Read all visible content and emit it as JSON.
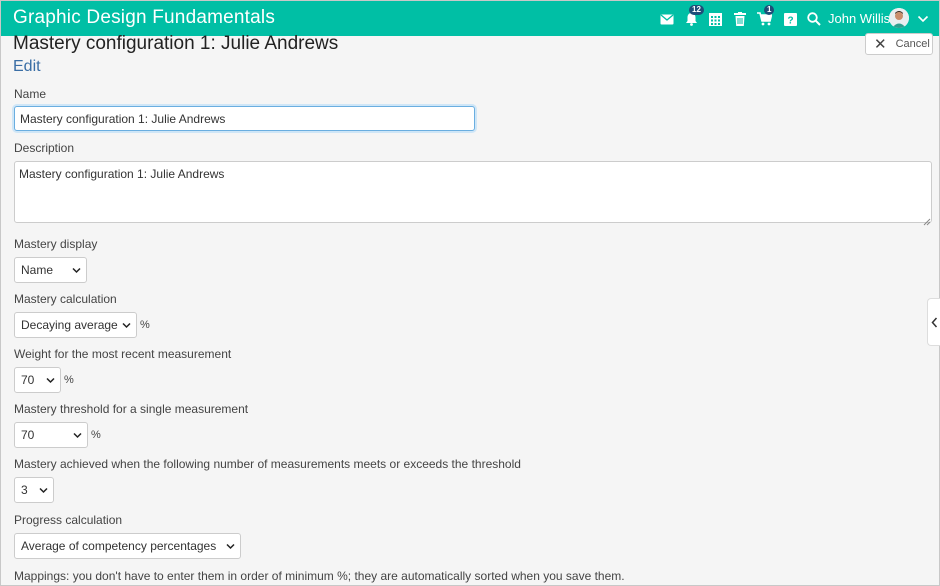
{
  "header": {
    "app_title": "Graphic Design Fundamentals",
    "user_name": "John Willis",
    "notifications_count": "12",
    "cart_count": "1",
    "icons": [
      "mail-icon",
      "bell-icon",
      "calendar-icon",
      "trash-icon",
      "cart-icon",
      "help-icon",
      "search-icon",
      "chevron-down-icon"
    ],
    "accent_color": "#00bfa5"
  },
  "page": {
    "title": "Mastery configuration 1: Julie Andrews",
    "cancel_label": "Cancel",
    "edit_heading": "Edit"
  },
  "form": {
    "name_label": "Name",
    "name_value": "Mastery configuration 1: Julie Andrews",
    "description_label": "Description",
    "description_value": "Mastery configuration 1: Julie Andrews",
    "display_label": "Mastery display",
    "display_value": "Name",
    "calculation_label": "Mastery calculation",
    "calculation_value": "Decaying average",
    "calculation_unit": "%",
    "weight_label": "Weight for the most recent measurement",
    "weight_value": "70",
    "weight_unit": "%",
    "threshold_label": "Mastery threshold for a single measurement",
    "threshold_value": "70",
    "threshold_unit": "%",
    "achieved_label": "Mastery achieved when the following number of measurements meets or exceeds the threshold",
    "achieved_value": "3",
    "progress_label": "Progress calculation",
    "progress_value": "Average of competency percentages",
    "mappings_note": "Mappings: you don't have to enter them in order of minimum %; they are automatically sorted when you save them."
  }
}
